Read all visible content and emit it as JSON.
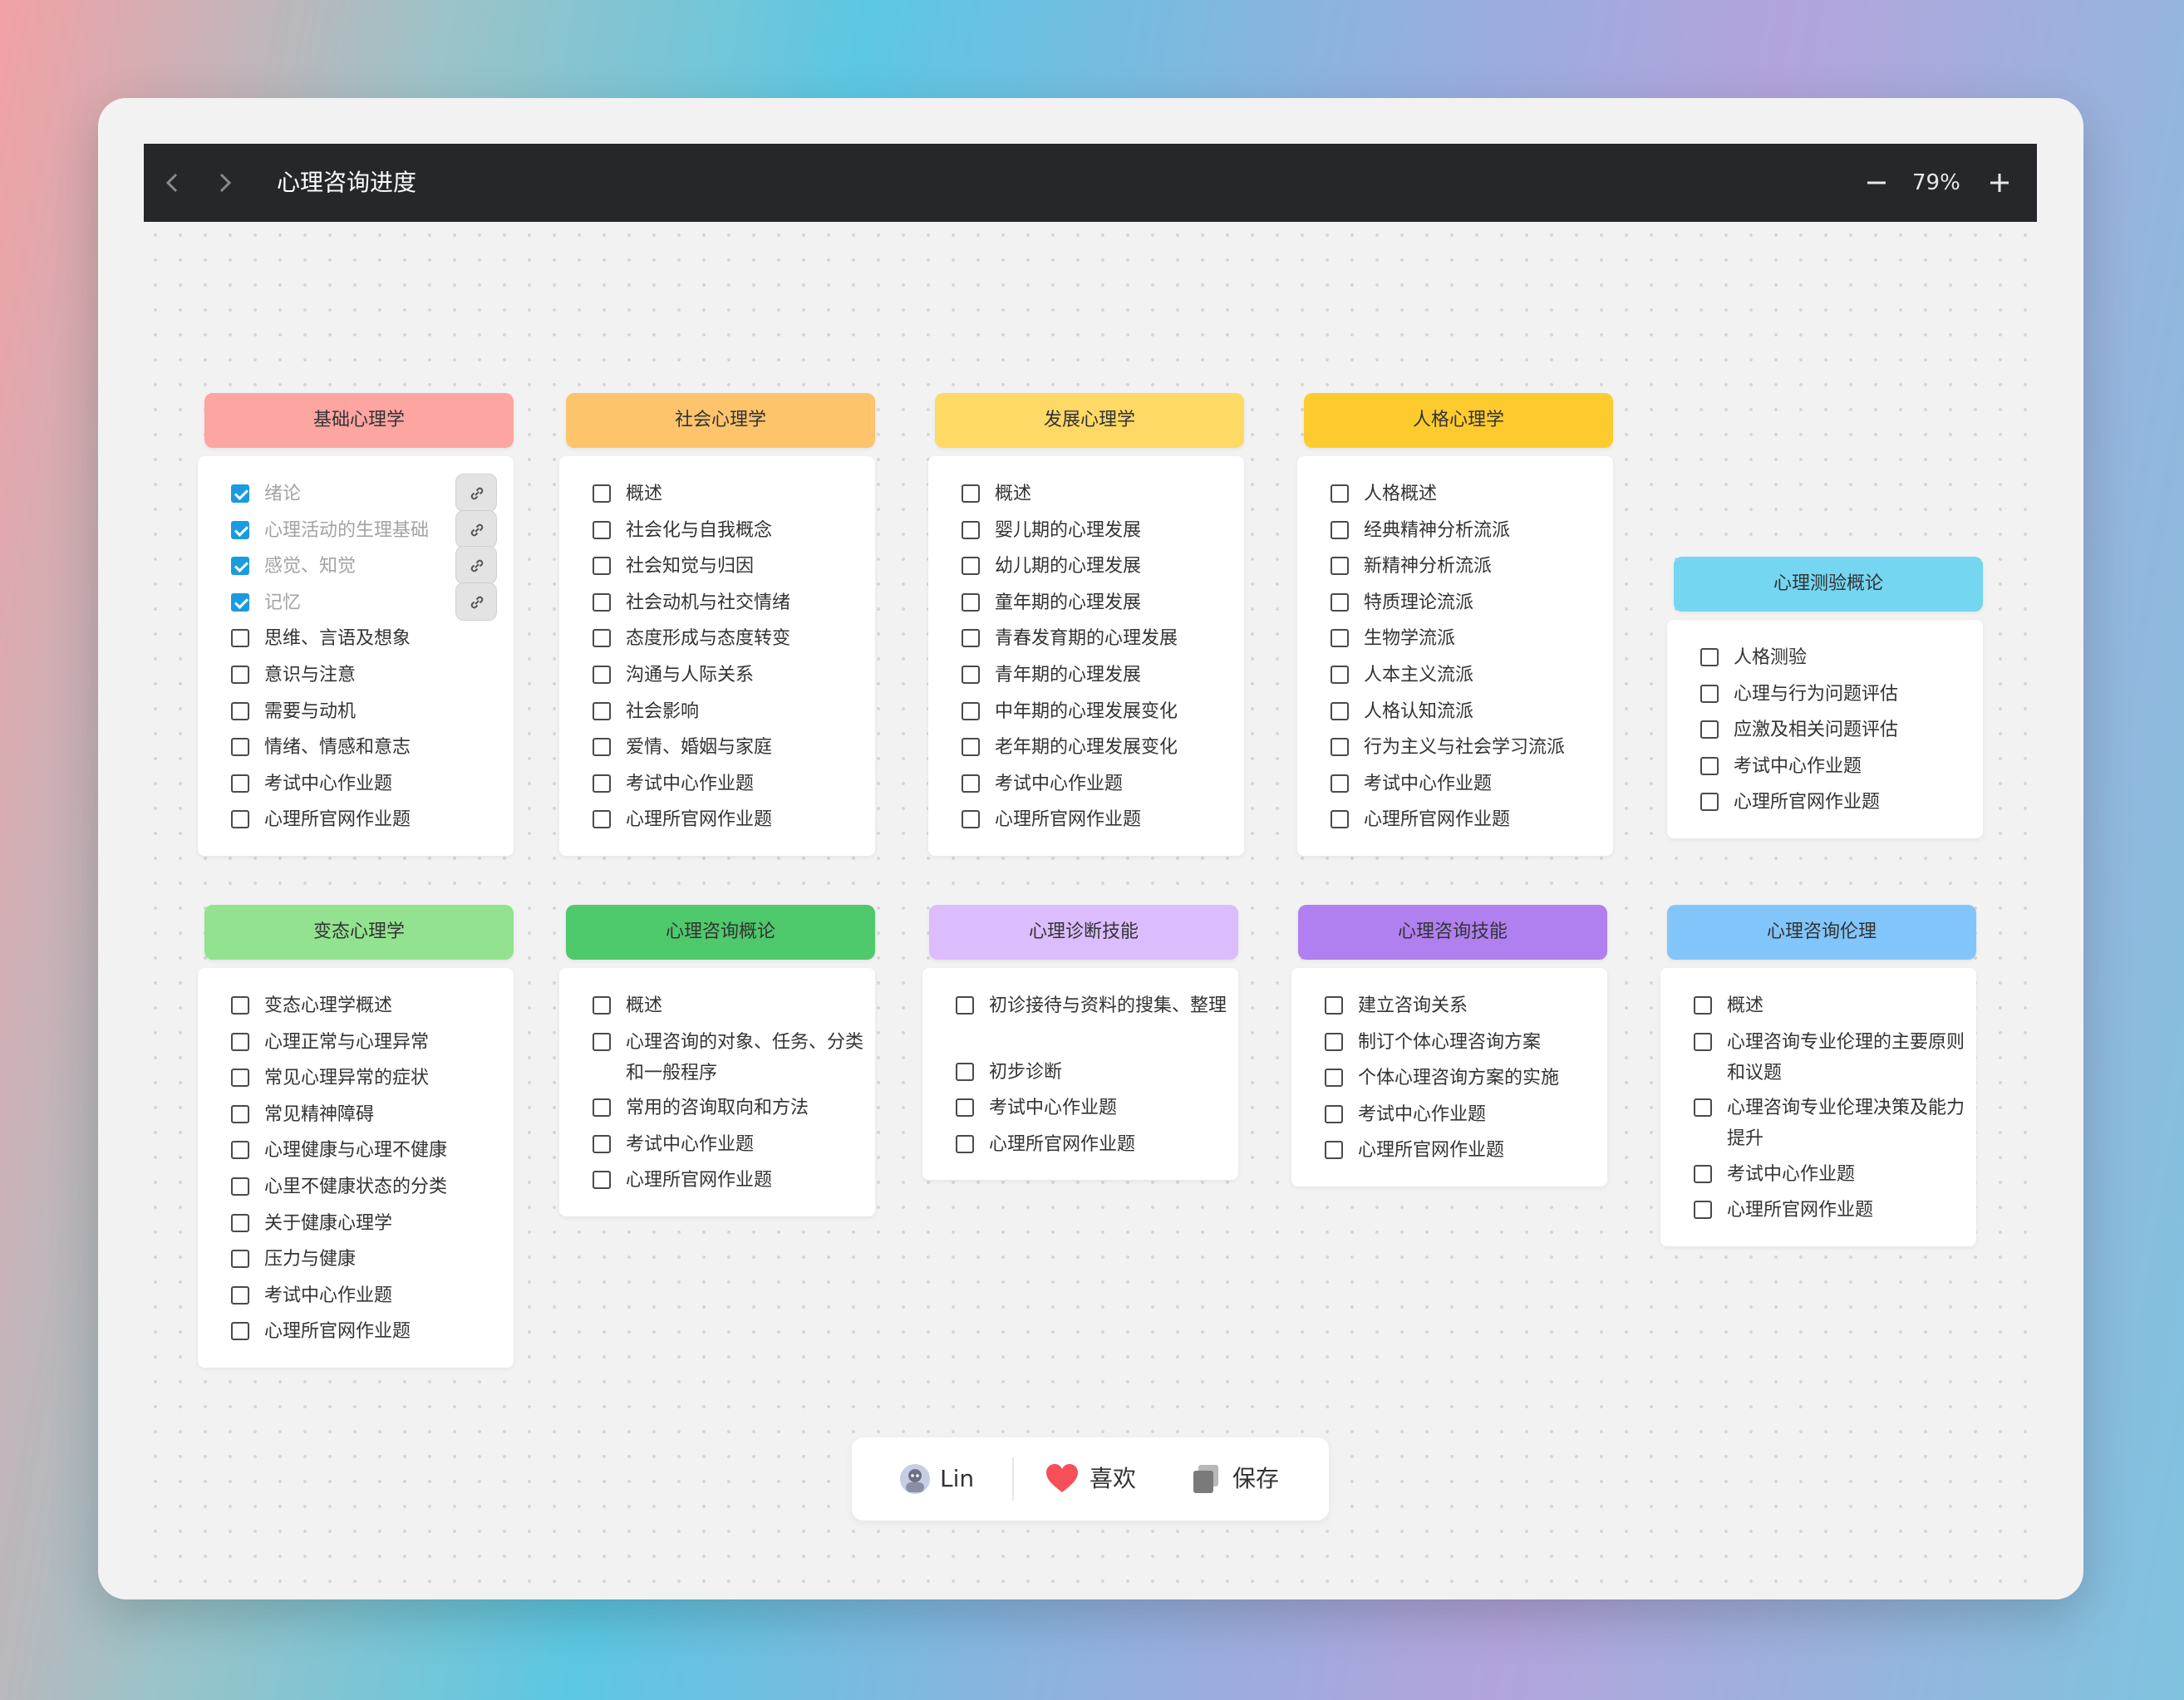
{
  "window": {
    "title": "心理咨询进度"
  },
  "toolbar": {
    "zoom_level": "79%",
    "back_icon": "chevron-left-icon",
    "forward_icon": "chevron-right-icon"
  },
  "groups": [
    {
      "name": "基础心理学",
      "color": "#fca5a1",
      "items": [
        {
          "label": "绪论",
          "checked": true
        },
        {
          "label": "心理活动的生理基础",
          "checked": true
        },
        {
          "label": "感觉、知觉",
          "checked": true
        },
        {
          "label": "记忆",
          "checked": true
        },
        {
          "label": "思维、言语及想象",
          "checked": false
        },
        {
          "label": "意识与注意",
          "checked": false
        },
        {
          "label": "需要与动机",
          "checked": false
        },
        {
          "label": "情绪、情感和意志",
          "checked": false
        },
        {
          "label": "考试中心作业题",
          "checked": false
        },
        {
          "label": "心理所官网作业题",
          "checked": false
        }
      ]
    },
    {
      "name": "社会心理学",
      "color": "#fdc46c",
      "items": [
        {
          "label": "概述",
          "checked": false
        },
        {
          "label": "社会化与自我概念",
          "checked": false
        },
        {
          "label": "社会知觉与归因",
          "checked": false
        },
        {
          "label": "社会动机与社交情绪",
          "checked": false
        },
        {
          "label": "态度形成与态度转变",
          "checked": false
        },
        {
          "label": "沟通与人际关系",
          "checked": false
        },
        {
          "label": "社会影响",
          "checked": false
        },
        {
          "label": "爱情、婚姻与家庭",
          "checked": false
        },
        {
          "label": "考试中心作业题",
          "checked": false
        },
        {
          "label": "心理所官网作业题",
          "checked": false
        }
      ]
    },
    {
      "name": "发展心理学",
      "color": "#fed966",
      "items": [
        {
          "label": "概述",
          "checked": false
        },
        {
          "label": "婴儿期的心理发展",
          "checked": false
        },
        {
          "label": "幼儿期的心理发展",
          "checked": false
        },
        {
          "label": "童年期的心理发展",
          "checked": false
        },
        {
          "label": "青春发育期的心理发展",
          "checked": false
        },
        {
          "label": "青年期的心理发展",
          "checked": false
        },
        {
          "label": "中年期的心理发展变化",
          "checked": false
        },
        {
          "label": "老年期的心理发展变化",
          "checked": false
        },
        {
          "label": "考试中心作业题",
          "checked": false
        },
        {
          "label": "心理所官网作业题",
          "checked": false
        }
      ]
    },
    {
      "name": "人格心理学",
      "color": "#fecb2f",
      "items": [
        {
          "label": "人格概述",
          "checked": false
        },
        {
          "label": "经典精神分析流派",
          "checked": false
        },
        {
          "label": "新精神分析流派",
          "checked": false
        },
        {
          "label": "特质理论流派",
          "checked": false
        },
        {
          "label": "生物学流派",
          "checked": false
        },
        {
          "label": "人本主义流派",
          "checked": false
        },
        {
          "label": "人格认知流派",
          "checked": false
        },
        {
          "label": "行为主义与社会学习流派",
          "checked": false
        },
        {
          "label": "考试中心作业题",
          "checked": false
        },
        {
          "label": "心理所官网作业题",
          "checked": false
        }
      ]
    },
    {
      "name": "心理测验概论",
      "color": "#74d6f0",
      "items": [
        {
          "label": "人格测验",
          "checked": false
        },
        {
          "label": "心理与行为问题评估",
          "checked": false
        },
        {
          "label": "应激及相关问题评估",
          "checked": false
        },
        {
          "label": "考试中心作业题",
          "checked": false
        },
        {
          "label": "心理所官网作业题",
          "checked": false
        }
      ]
    },
    {
      "name": "变态心理学",
      "color": "#93e28f",
      "items": [
        {
          "label": "变态心理学概述",
          "checked": false
        },
        {
          "label": "心理正常与心理异常",
          "checked": false
        },
        {
          "label": "常见心理异常的症状",
          "checked": false
        },
        {
          "label": "常见精神障碍",
          "checked": false
        },
        {
          "label": "心理健康与心理不健康",
          "checked": false
        },
        {
          "label": "心里不健康状态的分类",
          "checked": false
        },
        {
          "label": "关于健康心理学",
          "checked": false
        },
        {
          "label": "压力与健康",
          "checked": false
        },
        {
          "label": "考试中心作业题",
          "checked": false
        },
        {
          "label": "心理所官网作业题",
          "checked": false
        }
      ]
    },
    {
      "name": "心理咨询概论",
      "color": "#4ec96c",
      "items": [
        {
          "label": "概述",
          "checked": false
        },
        {
          "label": "心理咨询的对象、任务、分类和一般程序",
          "checked": false
        },
        {
          "label": "常用的咨询取向和方法",
          "checked": false
        },
        {
          "label": "考试中心作业题",
          "checked": false
        },
        {
          "label": "心理所官网作业题",
          "checked": false
        }
      ]
    },
    {
      "name": "心理诊断技能",
      "color": "#dbbcfc",
      "items": [
        {
          "label": "初诊接待与资料的搜集、整理",
          "checked": false
        },
        {
          "label": "初步诊断",
          "checked": false
        },
        {
          "label": "考试中心作业题",
          "checked": false
        },
        {
          "label": "心理所官网作业题",
          "checked": false
        }
      ]
    },
    {
      "name": "心理咨询技能",
      "color": "#b07ff0",
      "items": [
        {
          "label": "建立咨询关系",
          "checked": false
        },
        {
          "label": "制订个体心理咨询方案",
          "checked": false
        },
        {
          "label": "个体心理咨询方案的实施",
          "checked": false
        },
        {
          "label": "考试中心作业题",
          "checked": false
        },
        {
          "label": "心理所官网作业题",
          "checked": false
        }
      ]
    },
    {
      "name": "心理咨询伦理",
      "color": "#82c5fb",
      "items": [
        {
          "label": "概述",
          "checked": false
        },
        {
          "label": "心理咨询专业伦理的主要原则和议题",
          "checked": false
        },
        {
          "label": "心理咨询专业伦理决策及能力提升",
          "checked": false
        },
        {
          "label": "考试中心作业题",
          "checked": false
        },
        {
          "label": "心理所官网作业题",
          "checked": false
        }
      ]
    }
  ],
  "footer": {
    "user": "Lin",
    "like_label": "喜欢",
    "save_label": "保存"
  }
}
